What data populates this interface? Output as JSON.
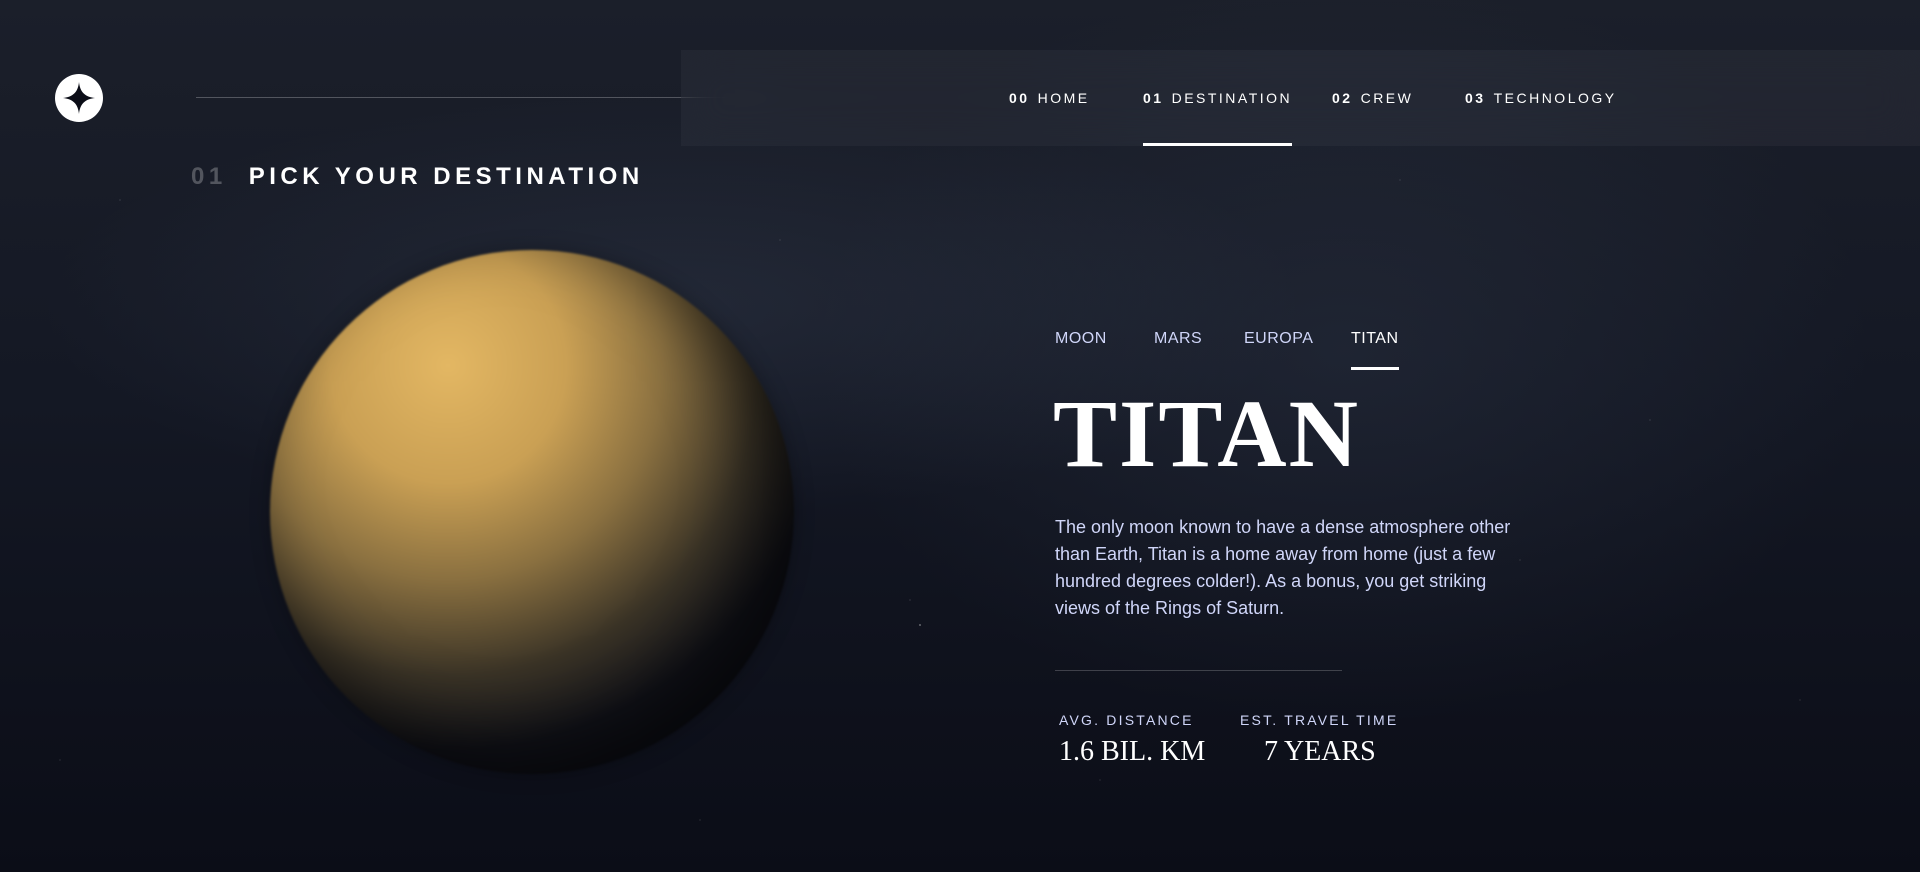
{
  "nav": {
    "items": [
      {
        "num": "00",
        "label": "HOME"
      },
      {
        "num": "01",
        "label": "DESTINATION"
      },
      {
        "num": "02",
        "label": "CREW"
      },
      {
        "num": "03",
        "label": "TECHNOLOGY"
      }
    ],
    "active": "DESTINATION"
  },
  "heading": {
    "num": "01",
    "title": "PICK YOUR DESTINATION"
  },
  "tabs": {
    "items": [
      "MOON",
      "MARS",
      "EUROPA",
      "TITAN"
    ],
    "active": "TITAN"
  },
  "destination": {
    "name": "TITAN",
    "description": "The only moon known to have a dense atmosphere other than Earth, Titan is a home away from home (just a few hundred degrees colder!). As a bonus, you get striking views of the Rings of Saturn.",
    "stats": [
      {
        "label": "AVG. DISTANCE",
        "value": "1.6 BIL. KM"
      },
      {
        "label": "EST. TRAVEL TIME",
        "value": "7 YEARS"
      }
    ]
  },
  "icons": {
    "logo": "star-logo-icon",
    "planet": "planet-image"
  }
}
